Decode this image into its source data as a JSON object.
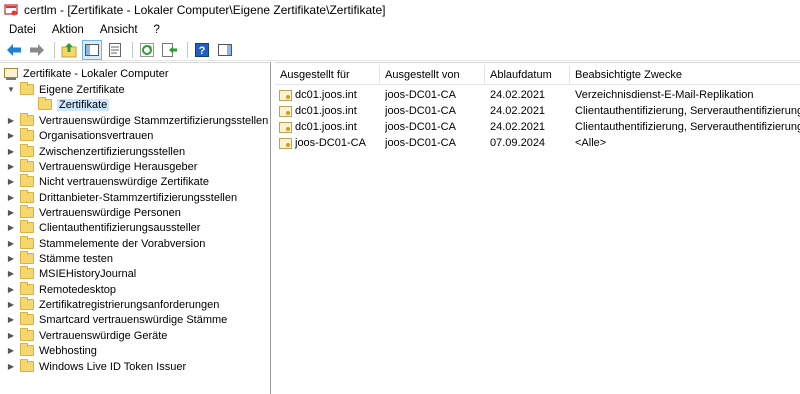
{
  "window": {
    "title": "certlm - [Zertifikate - Lokaler Computer\\Eigene Zertifikate\\Zertifikate]"
  },
  "menu": [
    "Datei",
    "Aktion",
    "Ansicht",
    "?"
  ],
  "toolbar": [
    {
      "icon": "back-arrow-icon"
    },
    {
      "icon": "forward-arrow-icon"
    },
    {
      "icon": "up-folder-icon"
    },
    {
      "icon": "show-hide-console-tree-icon"
    },
    {
      "icon": "properties-icon"
    },
    {
      "icon": "refresh-icon"
    },
    {
      "icon": "export-list-icon"
    },
    {
      "icon": "help-icon"
    },
    {
      "icon": "action-pane-icon"
    }
  ],
  "tree": {
    "root": "Zertifikate - Lokaler Computer",
    "items": [
      {
        "label": "Eigene Zertifikate",
        "expanded": true
      },
      {
        "label": "Zertifikate",
        "selected": true
      },
      {
        "label": "Vertrauenswürdige Stammzertifizierungsstellen"
      },
      {
        "label": "Organisationsvertrauen"
      },
      {
        "label": "Zwischenzertifizierungsstellen"
      },
      {
        "label": "Vertrauenswürdige Herausgeber"
      },
      {
        "label": "Nicht vertrauenswürdige Zertifikate"
      },
      {
        "label": "Drittanbieter-Stammzertifizierungsstellen"
      },
      {
        "label": "Vertrauenswürdige Personen"
      },
      {
        "label": "Clientauthentifizierungsaussteller"
      },
      {
        "label": "Stammelemente der Vorabversion"
      },
      {
        "label": "Stämme testen"
      },
      {
        "label": "MSIEHistoryJournal"
      },
      {
        "label": "Remotedesktop"
      },
      {
        "label": "Zertifikatregistrierungsanforderungen"
      },
      {
        "label": "Smartcard vertrauenswürdige Stämme"
      },
      {
        "label": "Vertrauenswürdige Geräte"
      },
      {
        "label": "Webhosting"
      },
      {
        "label": "Windows Live ID Token Issuer"
      }
    ]
  },
  "list": {
    "columns": [
      "Ausgestellt für",
      "Ausgestellt von",
      "Ablaufdatum",
      "Beabsichtigte Zwecke"
    ],
    "rows": [
      [
        "dc01.joos.int",
        "joos-DC01-CA",
        "24.02.2021",
        "Verzeichnisdienst-E-Mail-Replikation"
      ],
      [
        "dc01.joos.int",
        "joos-DC01-CA",
        "24.02.2021",
        "Clientauthentifizierung, Serverauthentifizierung, S"
      ],
      [
        "dc01.joos.int",
        "joos-DC01-CA",
        "24.02.2021",
        "Clientauthentifizierung, Serverauthentifizierung, S"
      ],
      [
        "joos-DC01-CA",
        "joos-DC01-CA",
        "07.09.2024",
        "<Alle>"
      ]
    ]
  }
}
